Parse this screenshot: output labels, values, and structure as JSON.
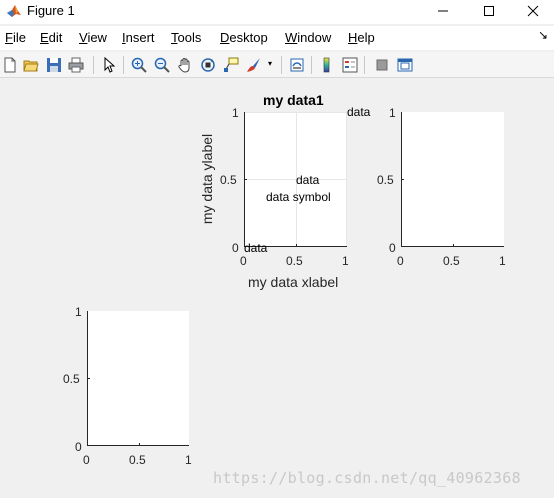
{
  "window": {
    "title": "Figure 1"
  },
  "menu": {
    "items": [
      {
        "label": "File",
        "underline": "F",
        "rest": "ile"
      },
      {
        "label": "Edit",
        "underline": "E",
        "rest": "dit"
      },
      {
        "label": "View",
        "underline": "V",
        "rest": "iew"
      },
      {
        "label": "Insert",
        "underline": "I",
        "rest": "nsert"
      },
      {
        "label": "Tools",
        "underline": "T",
        "rest": "ools"
      },
      {
        "label": "Desktop",
        "underline": "D",
        "rest": "esktop"
      },
      {
        "label": "Window",
        "underline": "W",
        "rest": "indow"
      },
      {
        "label": "Help",
        "underline": "H",
        "rest": "elp"
      }
    ],
    "dock_arrow": "↘"
  },
  "toolbar": {
    "buttons": [
      "new-figure-icon",
      "open-file-icon",
      "save-icon",
      "print-icon",
      "edit-plot-arrow-icon",
      "zoom-in-icon",
      "zoom-out-icon",
      "pan-hand-icon",
      "rotate-3d-icon",
      "data-cursor-icon",
      "brush-icon",
      "link-plot-icon",
      "colorbar-icon",
      "legend-icon",
      "hide-plot-tools-icon",
      "show-plot-tools-icon"
    ]
  },
  "axes": [
    {
      "id": "axes1",
      "title": "my data1",
      "xlabel": "my data xlabel",
      "ylabel": "my data ylabel",
      "xticks": [
        "0",
        "0.5",
        "1"
      ],
      "yticks": [
        "0",
        "0.5",
        "1"
      ],
      "grid": true,
      "texts": [
        "data",
        "data",
        "data symbol",
        "data"
      ]
    },
    {
      "id": "axes2",
      "title": "",
      "xlabel": "",
      "ylabel": "",
      "xticks": [
        "0",
        "0.5",
        "1"
      ],
      "yticks": [
        "0",
        "0.5",
        "1"
      ],
      "grid": false
    },
    {
      "id": "axes3",
      "title": "",
      "xlabel": "",
      "ylabel": "",
      "xticks": [
        "0",
        "0.5",
        "1"
      ],
      "yticks": [
        "0",
        "0.5",
        "1"
      ],
      "grid": false
    }
  ],
  "watermark": "https://blog.csdn.net/qq_40962368",
  "colors": {
    "axes_background": "#ffffff",
    "figure_background": "#f0f0f0",
    "axis_color": "#262626",
    "grid_color": "#e6e6e6"
  }
}
